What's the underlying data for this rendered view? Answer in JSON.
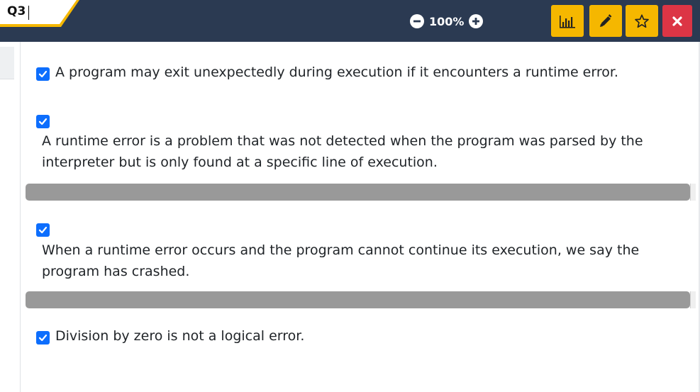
{
  "header": {
    "tab_label": "Q3",
    "zoom_value": "100%",
    "zoom_out_icon": "minus-circle-icon",
    "zoom_in_icon": "plus-circle-icon",
    "buttons": [
      {
        "name": "stats-button",
        "icon": "bar-chart-icon",
        "color": "#f5b700"
      },
      {
        "name": "edit-button",
        "icon": "pencil-icon",
        "color": "#f5b700"
      },
      {
        "name": "favorite-button",
        "icon": "star-icon",
        "color": "#f5b700"
      },
      {
        "name": "close-button",
        "icon": "close-icon",
        "color": "#dc3545"
      }
    ]
  },
  "statements": [
    {
      "text": "A program may exit unexpectedly during execution if it encounters a runtime error.",
      "checked": true
    },
    {
      "text": "A runtime error is a problem that was not detected when the program was parsed by the interpreter but is only found at a specific line of execution.",
      "checked": true
    },
    {
      "text": "When a runtime error occurs and the program cannot continue its execution, we say the program has crashed.",
      "checked": true
    },
    {
      "text": "Division by zero is not a logical error.",
      "checked": true
    }
  ],
  "colors": {
    "topbar": "#2b3a52",
    "accent_yellow": "#f5b700",
    "accent_red": "#dc3545",
    "checkbox": "#0d6efd"
  }
}
